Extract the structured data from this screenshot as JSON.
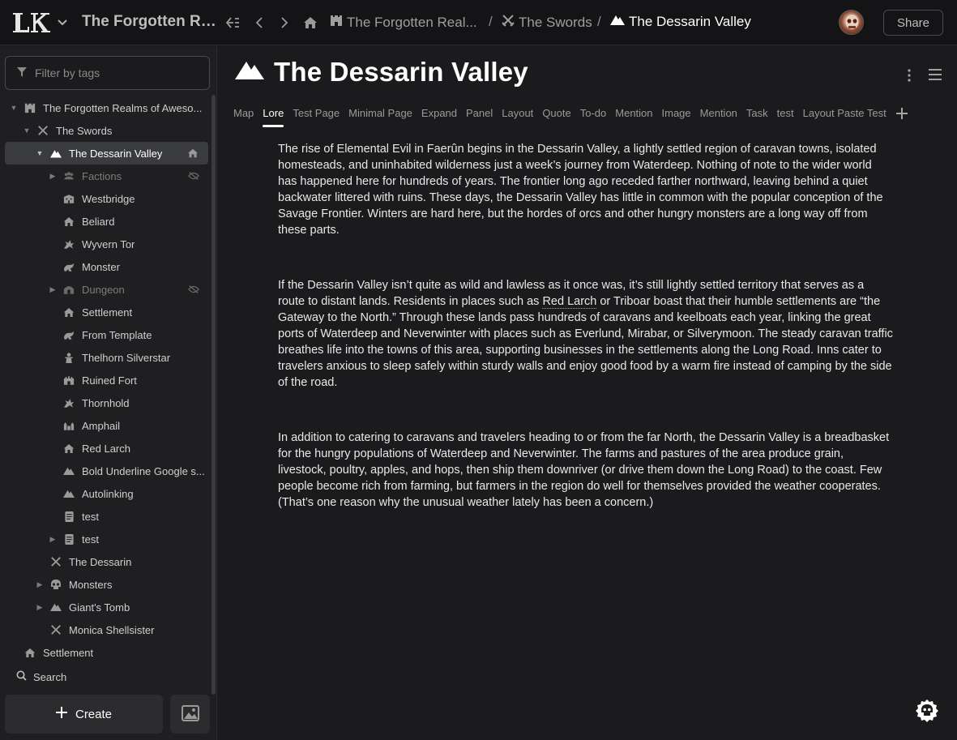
{
  "topbar": {
    "app_title": "The Forgotten Re...",
    "crumbs": [
      {
        "label": "The Forgotten Real..."
      },
      {
        "label": "The Swords"
      },
      {
        "label": "The Dessarin Valley"
      }
    ],
    "separator": "/",
    "share_label": "Share"
  },
  "sidebar": {
    "filter_placeholder": "Filter by tags",
    "tree": [
      {
        "label": "The Forgotten Realms of Aweso...",
        "icon": "castle-icon"
      },
      {
        "label": "The Swords",
        "icon": "crossed-swords-icon"
      },
      {
        "label": "The Dessarin Valley",
        "icon": "mountain-icon"
      },
      {
        "label": "Factions",
        "icon": "group-icon"
      },
      {
        "label": "Westbridge",
        "icon": "building-icon"
      },
      {
        "label": "Beliard",
        "icon": "house-icon"
      },
      {
        "label": "Wyvern Tor",
        "icon": "dragon-icon"
      },
      {
        "label": "Monster",
        "icon": "creature-icon"
      },
      {
        "label": "Dungeon",
        "icon": "dungeon-icon"
      },
      {
        "label": "Settlement",
        "icon": "house-icon"
      },
      {
        "label": "From Template",
        "icon": "creature-icon"
      },
      {
        "label": "Thelhorn Silverstar",
        "icon": "person-icon"
      },
      {
        "label": "Ruined Fort",
        "icon": "fort-icon"
      },
      {
        "label": "Thornhold",
        "icon": "dragon-icon"
      },
      {
        "label": "Amphail",
        "icon": "village-icon"
      },
      {
        "label": "Red Larch",
        "icon": "house-icon"
      },
      {
        "label": "Bold Underline Google s...",
        "icon": "mountain-icon"
      },
      {
        "label": "Autolinking",
        "icon": "mountain-icon"
      },
      {
        "label": "test",
        "icon": "document-icon"
      },
      {
        "label": "test",
        "icon": "document-icon"
      },
      {
        "label": "The Dessarin",
        "icon": "crossed-swords-icon"
      },
      {
        "label": "Monsters",
        "icon": "skull-icon"
      },
      {
        "label": "Giant's Tomb",
        "icon": "mountain-icon"
      },
      {
        "label": "Monica Shellsister",
        "icon": "crossed-swords-icon"
      },
      {
        "label": "Settlement",
        "icon": "house-icon"
      }
    ],
    "search_label": "Search",
    "create_label": "Create"
  },
  "page": {
    "title": "The Dessarin Valley",
    "tabs": [
      "Map",
      "Lore",
      "Test Page",
      "Minimal Page",
      "Expand",
      "Panel",
      "Layout",
      "Quote",
      "To-do",
      "Mention",
      "Image",
      "Mention",
      "Task",
      "test",
      "Layout Paste Test"
    ],
    "active_tab": "Lore",
    "paragraphs": [
      {
        "text": "The rise of Elemental Evil in Faerûn begins in the Dessarin Valley, a lightly settled region of caravan towns, isolated homesteads, and uninhabited wilderness just a week’s journey from Waterdeep. Nothing of note to the wider world has happened here for hundreds of years. The frontier long ago receded farther northward, leaving behind a quiet backwater littered with ruins. These days, the Dessarin Valley has little in common with the popular conception of the Savage Frontier. Winters are hard here, but the hordes of orcs and other hungry monsters are a long way off from these parts."
      },
      {
        "before": "If the Dessarin Valley isn’t quite as wild and lawless as it once was, it’s still lightly settled territory that serves as a route to distant lands. Residents in places such as ",
        "mention": "Red Larch",
        "after": " or Triboar boast that their humble settlements are “the Gateway to the North.” Through these lands pass hundreds of caravans and keelboats each year, linking the great ports of Waterdeep and Neverwinter with places such as Everlund, Mirabar, or Silverymoon. The steady caravan traffic breathes life into the towns of this area, supporting businesses in the settlements along the Long Road. Inns cater to travelers anxious to sleep safely within sturdy walls and enjoy good food by a warm fire instead of camping by the side of the road."
      },
      {
        "text": "In addition to catering to caravans and travelers heading to or from the far North, the Dessarin Valley is a breadbasket for the hungry populations of Waterdeep and Neverwinter. The farms and pastures of the area produce grain, livestock, poultry, apples, and hops, then ship them downriver (or drive them down the Long Road) to the coast. Few people become rich from farming, but farmers in the region do well for themselves provided the weather cooperates. (That’s one reason why the unusual weather lately has been a concern.)"
      }
    ]
  }
}
